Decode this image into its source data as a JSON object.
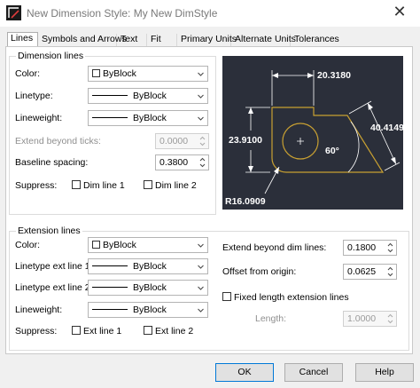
{
  "window": {
    "title": "New Dimension Style: My New DimStyle",
    "close_glyph": "✕"
  },
  "tabs": [
    "Lines",
    "Symbols and Arrows",
    "Text",
    "Fit",
    "Primary Units",
    "Alternate Units",
    "Tolerances"
  ],
  "dimension_lines": {
    "title": "Dimension lines",
    "color_label": "Color:",
    "color_value": "ByBlock",
    "linetype_label": "Linetype:",
    "linetype_value": "ByBlock",
    "lineweight_label": "Lineweight:",
    "lineweight_value": "ByBlock",
    "extend_label": "Extend beyond ticks:",
    "extend_value": "0.0000",
    "baseline_label": "Baseline spacing:",
    "baseline_value": "0.3800",
    "suppress_label": "Suppress:",
    "dim_line_1": "Dim line 1",
    "dim_line_2": "Dim line 2"
  },
  "extension_lines": {
    "title": "Extension lines",
    "color_label": "Color:",
    "color_value": "ByBlock",
    "linetype1_label": "Linetype ext line 1:",
    "linetype1_value": "ByBlock",
    "linetype2_label": "Linetype ext line 2:",
    "linetype2_value": "ByBlock",
    "lineweight_label": "Lineweight:",
    "lineweight_value": "ByBlock",
    "suppress_label": "Suppress:",
    "ext_line_1": "Ext line 1",
    "ext_line_2": "Ext line 2",
    "extend_beyond_label": "Extend beyond dim lines:",
    "extend_beyond_value": "0.1800",
    "offset_label": "Offset from origin:",
    "offset_value": "0.0625",
    "fixed_length_label": "Fixed length extension lines",
    "length_label": "Length:",
    "length_value": "1.0000"
  },
  "preview": {
    "dim_top": "20.3180",
    "dim_left": "23.9100",
    "dim_right": "40.4149",
    "dim_angle": "60°",
    "dim_radius": "R16.0909",
    "colors": {
      "background": "#2b2f3a",
      "geometry": "#c8a032",
      "dimension": "#ffffff"
    }
  },
  "buttons": {
    "ok": "OK",
    "cancel": "Cancel",
    "help": "Help"
  }
}
